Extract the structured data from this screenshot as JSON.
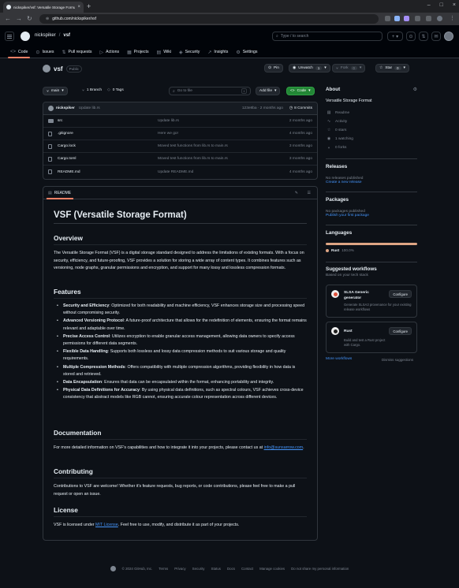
{
  "browser": {
    "tab_title": "nickspiker/vsf: Versatile Storage Format",
    "url": "github.com/nickspiker/vsf"
  },
  "header": {
    "owner": "nickspiker",
    "separator": "/",
    "repo": "vsf",
    "search_placeholder": "Type / to search",
    "plus_label": "+ ▾"
  },
  "repo_nav": [
    {
      "label": "Code",
      "icon": "<>"
    },
    {
      "label": "Issues",
      "icon": "⊙"
    },
    {
      "label": "Pull requests",
      "icon": "⇅"
    },
    {
      "label": "Actions",
      "icon": "▷"
    },
    {
      "label": "Projects",
      "icon": "▦"
    },
    {
      "label": "Wiki",
      "icon": "▤"
    },
    {
      "label": "Security",
      "icon": "◈"
    },
    {
      "label": "Insights",
      "icon": "↗"
    },
    {
      "label": "Settings",
      "icon": "⚙"
    }
  ],
  "repo": {
    "name": "vsf",
    "visibility": "Public",
    "pin": "Pin",
    "watch": "Unwatch",
    "watch_count": "1",
    "fork": "Fork",
    "fork_count": "0",
    "star": "Star",
    "star_count": "0"
  },
  "branch": {
    "name": "main",
    "branches": "1 Branch",
    "tags": "0 Tags",
    "goto_placeholder": "Go to file",
    "goto_key": "t",
    "add_file": "Add file",
    "code": "Code"
  },
  "commit": {
    "author": "nickspiker",
    "message": "Update lib.rs",
    "hash_time": "123e8ba · 2 months ago",
    "commits": "8 Commits"
  },
  "files": [
    {
      "name": "src",
      "type": "folder",
      "message": "Update lib.rs",
      "date": "2 months ago"
    },
    {
      "name": ".gitignore",
      "type": "file",
      "message": "Here we go!",
      "date": "4 months ago"
    },
    {
      "name": "Cargo.lock",
      "type": "file",
      "message": "Moved test functions from lib.rs to main.rs",
      "date": "3 months ago"
    },
    {
      "name": "Cargo.toml",
      "type": "file",
      "message": "Moved test functions from lib.rs to main.rs",
      "date": "3 months ago"
    },
    {
      "name": "README.md",
      "type": "file",
      "message": "Update README.md",
      "date": "4 months ago"
    }
  ],
  "readme": {
    "tab": "README",
    "title": "VSF (Versatile Storage Format)",
    "overview_h": "Overview",
    "overview_p": "The Versatile Storage Format (VSF) is a digital storage standard designed to address the limitations of existing formats. With a focus on security, efficiency, and future-proofing, VSF provides a solution for storing a wide array of content types. It combines features such as versioning, node graphs, granular permissions and encryption, and support for many lossy and lossless compression formats.",
    "features_h": "Features",
    "features": [
      {
        "b": "Security and Efficiency",
        "t": ": Optimized for both readability and machine efficiency, VSF enhances storage size and processing speed without compromising security."
      },
      {
        "b": "Advanced Versioning Protocol",
        "t": ": A future-proof architecture that allows for the redefinition of elements, ensuring the format remains relevant and adaptable over time."
      },
      {
        "b": "Precise Access Control",
        "t": ": Utilizes encryption to enable granular access management, allowing data owners to specify access permissions for different data segments."
      },
      {
        "b": "Flexible Data Handling",
        "t": ": Supports both lossless and lossy data compression methods to suit various storage and quality requirements."
      },
      {
        "b": "Multiple Compression Methods",
        "t": ": Offers compatibility with multiple compression algorithms, providing flexibility in how data is stored and retrieved."
      },
      {
        "b": "Data Encapsulation",
        "t": ": Ensures that data can be encapsulated within the format, enhancing portability and integrity."
      },
      {
        "b": "Physical Data Definitions for Accuracy",
        "t": ": By using physical data definitions, such as spectral colours, VSF achieves cross-device consistency that abstract models like RGB cannot, ensuring accurate colour representation across different devices."
      }
    ],
    "doc_h": "Documentation",
    "doc_p": "For more detailed information on VSF's capabilities and how to integrate it into your projects, please contact us at ",
    "doc_link": "info@sunsarrow.com",
    "doc_end": ".",
    "contrib_h": "Contributing",
    "contrib_p": "Contributions to VSF are welcome! Whether it's feature requests, bug reports, or code contributions, please feel free to make a pull request or open an issue.",
    "license_h": "License",
    "license_pre": "VSF is licensed under ",
    "license_link": "MIT License",
    "license_post": ". Feel free to use, modify, and distribute it as part of your projects."
  },
  "about": {
    "title": "About",
    "desc": "Versatile Storage Format",
    "items": [
      {
        "icon": "▤",
        "label": "Readme"
      },
      {
        "icon": "∿",
        "label": "Activity"
      },
      {
        "icon": "☆",
        "label": "0 stars"
      },
      {
        "icon": "◉",
        "label": "1 watching"
      },
      {
        "icon": "⑂",
        "label": "0 forks"
      }
    ]
  },
  "releases": {
    "title": "Releases",
    "text": "No releases published",
    "link": "Create a new release"
  },
  "packages": {
    "title": "Packages",
    "text": "No packages published",
    "link": "Publish your first package"
  },
  "languages": {
    "title": "Languages",
    "lang": "Rust",
    "pct": "100.0%",
    "color": "#dea584"
  },
  "workflows": {
    "title": "Suggested workflows",
    "subtitle": "Based on your tech stack",
    "items": [
      {
        "title": "SLSA Generic generator",
        "desc": "Generate SLSA3 provenance for your existing release workflows",
        "button": "Configure",
        "color": "#e0533d"
      },
      {
        "title": "Rust",
        "desc": "Build and test a Rust project with Cargo.",
        "button": "Configure",
        "color": "#222222"
      }
    ],
    "more": "More workflows",
    "dismiss": "Dismiss suggestions"
  },
  "footer": {
    "copyright": "© 2024 GitHub, Inc.",
    "links": [
      "Terms",
      "Privacy",
      "Security",
      "Status",
      "Docs",
      "Contact",
      "Manage cookies",
      "Do not share my personal information"
    ]
  }
}
